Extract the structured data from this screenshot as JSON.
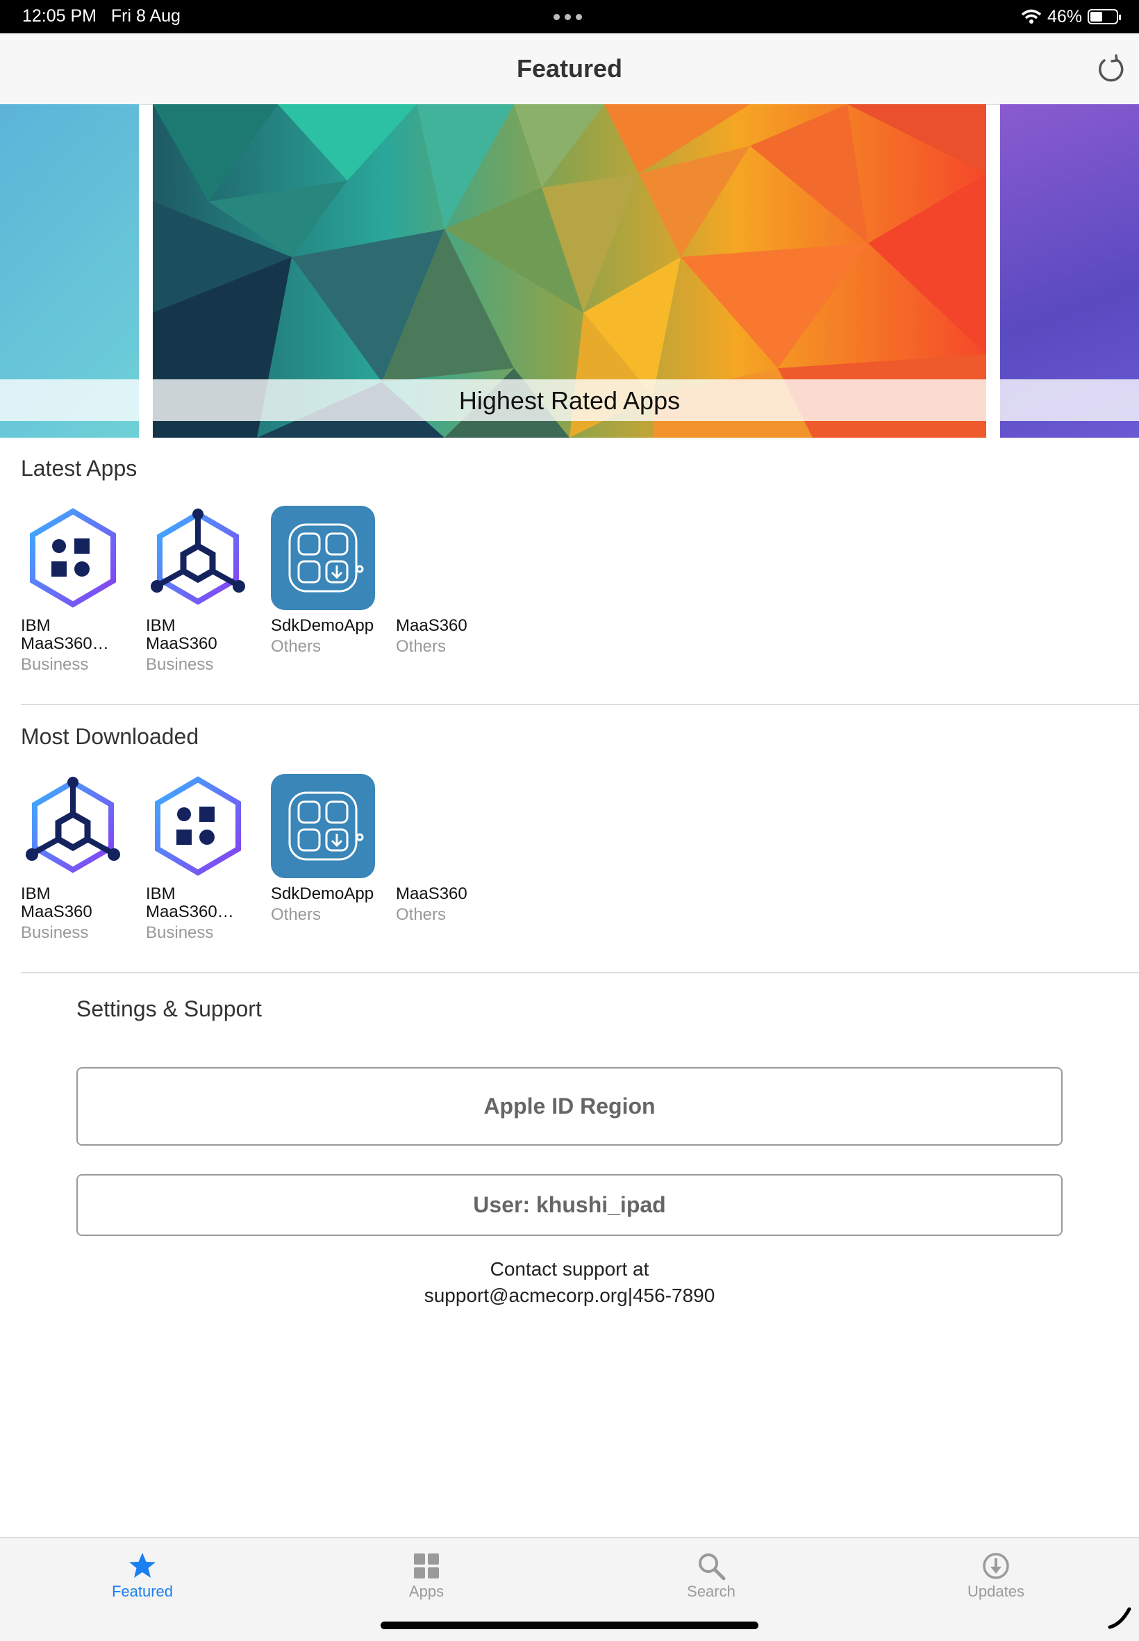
{
  "status_bar": {
    "time": "12:05 PM",
    "date": "Fri 8 Aug",
    "battery": "46%",
    "battery_level": 0.46
  },
  "nav": {
    "title": "Featured",
    "refresh_icon": "refresh-icon"
  },
  "carousel": {
    "current_caption": "Highest Rated Apps"
  },
  "latest": {
    "title": "Latest Apps",
    "apps": [
      {
        "name": "IBM\nMaaS360…",
        "category": "Business",
        "icon": "ibm-blocks-icon"
      },
      {
        "name": "IBM\nMaaS360",
        "category": "Business",
        "icon": "ibm-nodes-icon"
      },
      {
        "name": "SdkDemoApp",
        "category": "Others",
        "icon": "sdk-grid-icon"
      },
      {
        "name": "MaaS360",
        "category": "Others",
        "icon": ""
      }
    ]
  },
  "most": {
    "title": "Most Downloaded",
    "apps": [
      {
        "name": "IBM\nMaaS360",
        "category": "Business",
        "icon": "ibm-nodes-icon"
      },
      {
        "name": "IBM\nMaaS360…",
        "category": "Business",
        "icon": "ibm-blocks-icon"
      },
      {
        "name": "SdkDemoApp",
        "category": "Others",
        "icon": "sdk-grid-icon"
      },
      {
        "name": "MaaS360",
        "category": "Others",
        "icon": ""
      }
    ]
  },
  "settings": {
    "title": "Settings & Support",
    "region_button": "Apple ID Region",
    "user_button": "User: khushi_ipad",
    "contact_line1": "Contact support at",
    "contact_line2": "support@acmecorp.org|456-7890"
  },
  "tabs": [
    {
      "label": "Featured",
      "icon": "star-icon",
      "active": true
    },
    {
      "label": "Apps",
      "icon": "grid-icon",
      "active": false
    },
    {
      "label": "Search",
      "icon": "search-icon",
      "active": false
    },
    {
      "label": "Updates",
      "icon": "download-icon",
      "active": false
    }
  ],
  "colors": {
    "accent": "#1a7ff0",
    "sdk_icon_bg": "#3a86b8"
  }
}
